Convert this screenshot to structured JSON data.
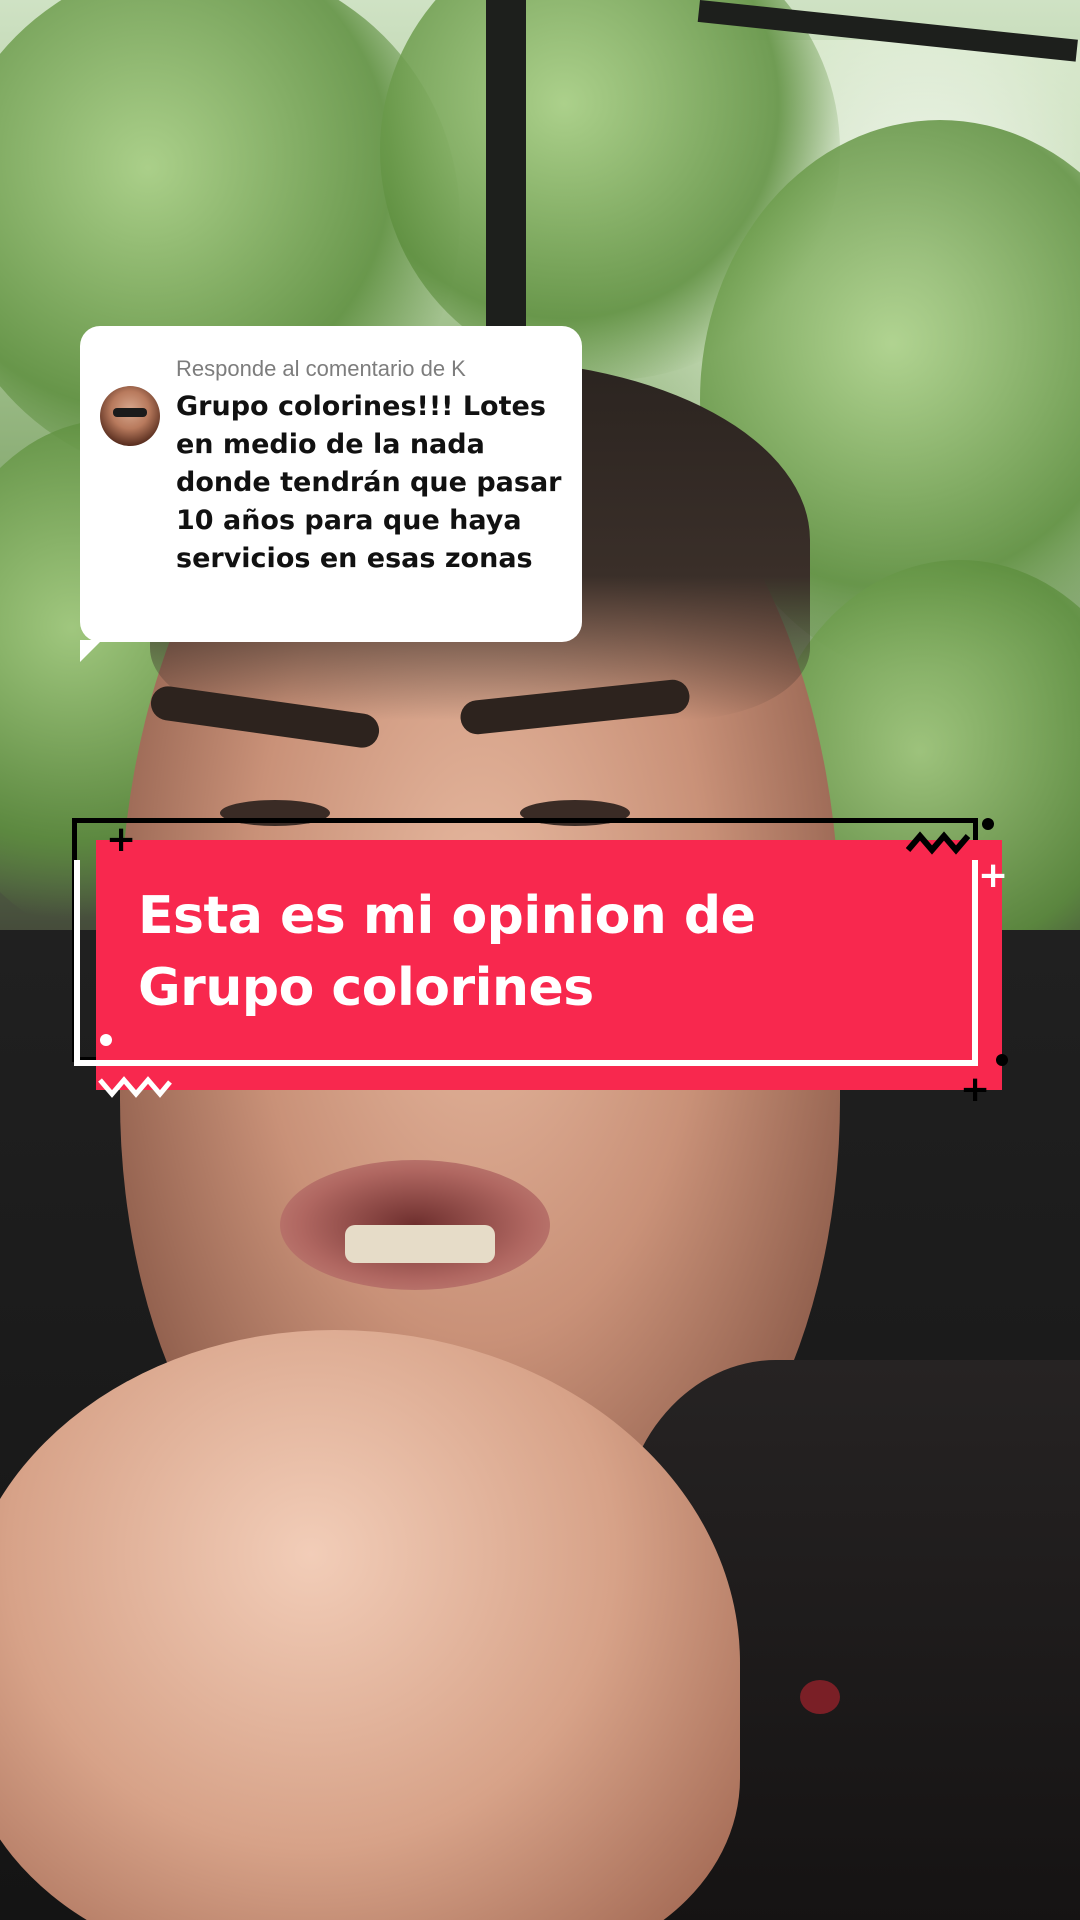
{
  "reply": {
    "header": "Responde al comentario de K",
    "comment": "Grupo colorines!!! Lotes en medio de la nada donde tendrán que pasar 10 años para que haya servicios en esas zonas"
  },
  "caption": {
    "text": "Esta es mi opinion de Grupo colorines"
  },
  "colors": {
    "banner": "#f8284e",
    "card": "#ffffff",
    "header_text": "#7d7d7d"
  },
  "icons": {
    "avatar": "commenter-avatar",
    "decorations": [
      "plus-icon",
      "zigzag-icon",
      "dot-icon"
    ]
  }
}
